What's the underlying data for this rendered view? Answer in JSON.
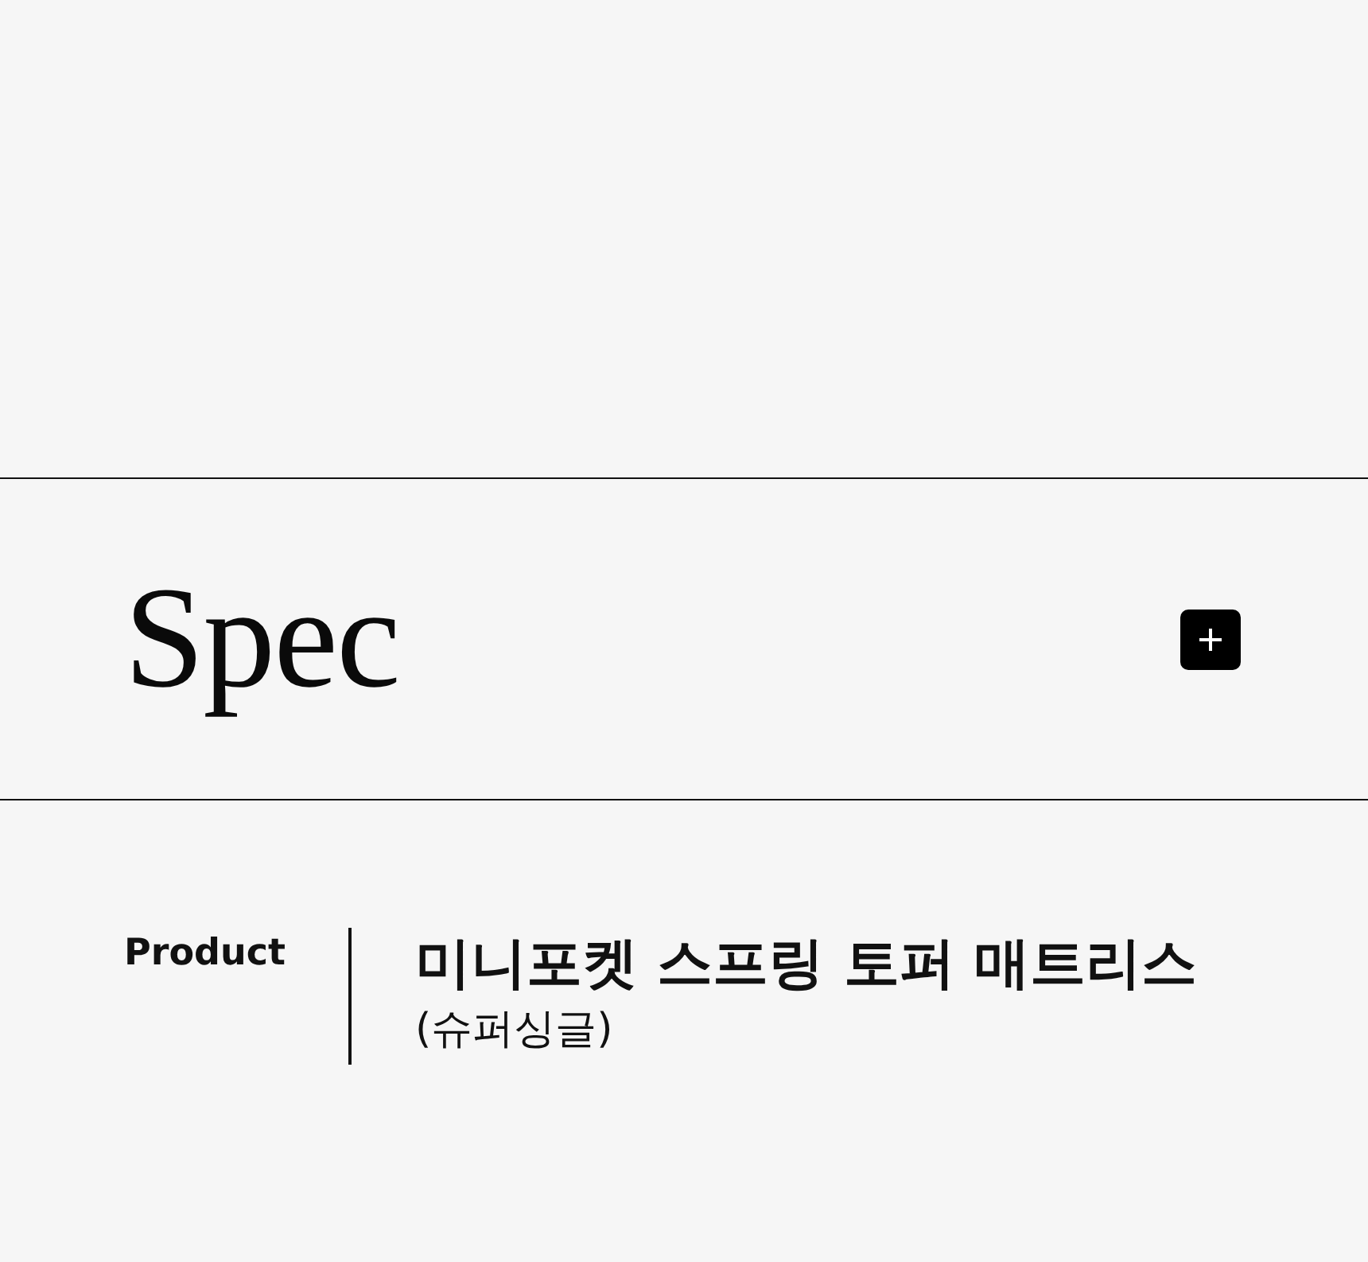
{
  "spec_section": {
    "title": "Spec",
    "expanded": false
  },
  "spec_rows": [
    {
      "label": "Product",
      "value": "미니포켓 스프링 토퍼 매트리스",
      "note": "(슈퍼싱글)"
    }
  ]
}
